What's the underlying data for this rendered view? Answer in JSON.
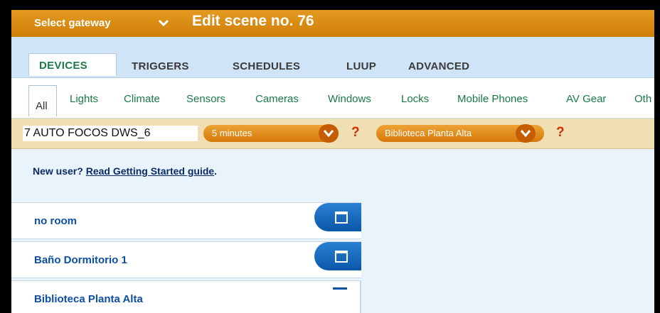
{
  "header": {
    "gateway_label": "Select gateway",
    "scene_title": "Edit scene no. 76"
  },
  "main_tabs": [
    {
      "label": "DEVICES",
      "active": true
    },
    {
      "label": "TRIGGERS"
    },
    {
      "label": "SCHEDULES"
    },
    {
      "label": "LUUP"
    },
    {
      "label": "ADVANCED"
    }
  ],
  "categories": [
    "All",
    "Lights",
    "Climate",
    "Sensors",
    "Cameras",
    "Windows",
    "Locks",
    "Mobile Phones",
    "AV Gear",
    "Oth"
  ],
  "device_row": {
    "name": "7 AUTO FOCOS DWS_6",
    "delay": "5 minutes",
    "room": "Biblioteca Planta Alta",
    "help": "?"
  },
  "help_text": {
    "prefix": "New user? ",
    "link": "Read Getting Started guide",
    "suffix": "."
  },
  "rooms": [
    {
      "name": "no room"
    },
    {
      "name": "Baño Dormitorio 1"
    },
    {
      "name": "Biblioteca Planta Alta"
    }
  ],
  "colors": {
    "header_orange": "#d98a12",
    "tab_green": "#1e7a4a",
    "room_blue": "#0d4fa3"
  }
}
